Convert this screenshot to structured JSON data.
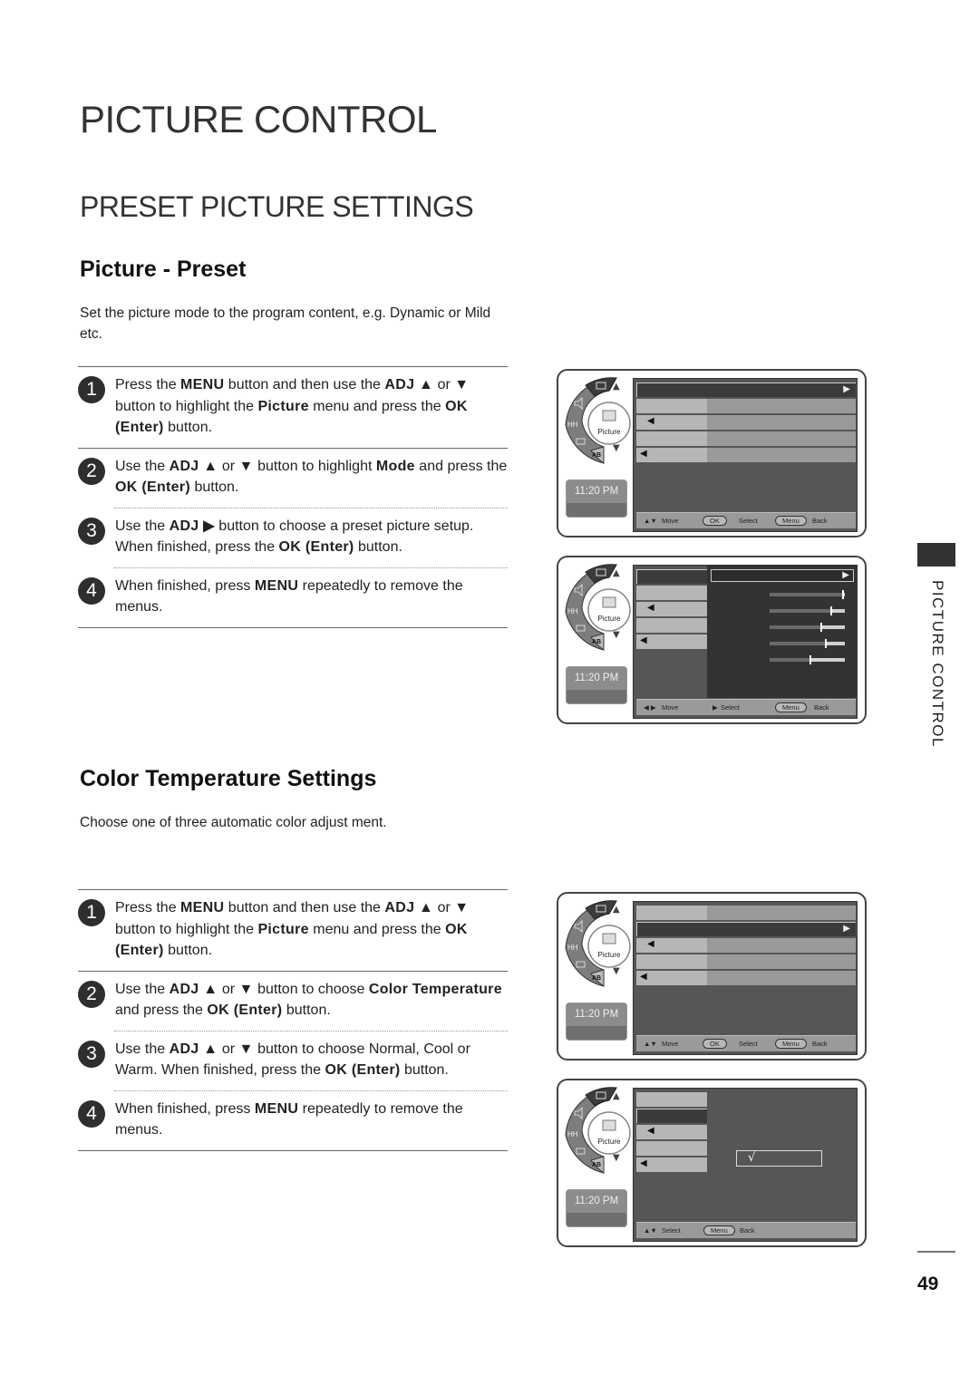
{
  "page": {
    "title": "PICTURE CONTROL",
    "section_title": "PRESET PICTURE SETTINGS",
    "side_label": "PICTURE CONTROL",
    "page_number": "49"
  },
  "preset": {
    "heading": "Picture - Preset",
    "intro": "Set the picture mode to the program content, e.g. Dynamic or Mild etc.",
    "steps": [
      {
        "num": "1",
        "parts": [
          [
            "t",
            "Press the "
          ],
          [
            "b",
            "MENU"
          ],
          [
            "t",
            " button and then use the "
          ],
          [
            "b",
            "ADJ ▲"
          ],
          [
            "t",
            " or "
          ],
          [
            "b",
            "▼"
          ],
          [
            "t",
            " button to highlight the "
          ],
          [
            "b",
            "Picture"
          ],
          [
            "t",
            " menu and press the "
          ],
          [
            "b",
            "OK (Enter)"
          ],
          [
            "t",
            " button."
          ]
        ]
      },
      {
        "num": "2",
        "parts": [
          [
            "t",
            "Use the "
          ],
          [
            "b",
            "ADJ ▲"
          ],
          [
            "t",
            " or "
          ],
          [
            "b",
            "▼"
          ],
          [
            "t",
            " button to highlight "
          ],
          [
            "b",
            "Mode"
          ],
          [
            "t",
            " and press the "
          ],
          [
            "b",
            "OK (Enter)"
          ],
          [
            "t",
            " button."
          ]
        ]
      },
      {
        "num": "3",
        "parts": [
          [
            "t",
            "Use the "
          ],
          [
            "b",
            "ADJ ▶"
          ],
          [
            "t",
            " button to choose a preset picture setup. When finished, press the "
          ],
          [
            "b",
            "OK (Enter)"
          ],
          [
            "t",
            " button."
          ]
        ]
      },
      {
        "num": "4",
        "parts": [
          [
            "t",
            "When finished, press "
          ],
          [
            "b",
            "MENU"
          ],
          [
            "t",
            " repeatedly to remove the menus."
          ]
        ]
      }
    ]
  },
  "colortemp": {
    "heading": "Color Temperature Settings",
    "intro": "Choose one of three automatic color adjust ment.",
    "steps": [
      {
        "num": "1",
        "parts": [
          [
            "t",
            "Press the "
          ],
          [
            "b",
            "MENU"
          ],
          [
            "t",
            " button and then use the "
          ],
          [
            "b",
            "ADJ ▲"
          ],
          [
            "t",
            " or "
          ],
          [
            "b",
            "▼"
          ],
          [
            "t",
            " button to highlight the "
          ],
          [
            "b",
            "Picture"
          ],
          [
            "t",
            " menu and press the "
          ],
          [
            "b",
            "OK (Enter)"
          ],
          [
            "t",
            " button."
          ]
        ]
      },
      {
        "num": "2",
        "parts": [
          [
            "t",
            "Use the "
          ],
          [
            "b",
            "ADJ ▲"
          ],
          [
            "t",
            " or "
          ],
          [
            "b",
            "▼"
          ],
          [
            "t",
            " button to choose "
          ],
          [
            "b",
            "Color Temperature"
          ],
          [
            "t",
            " and press the "
          ],
          [
            "b",
            "OK (Enter)"
          ],
          [
            "t",
            " button."
          ]
        ]
      },
      {
        "num": "3",
        "parts": [
          [
            "t",
            "Use the "
          ],
          [
            "b",
            "ADJ ▲"
          ],
          [
            "t",
            " or "
          ],
          [
            "b",
            "▼"
          ],
          [
            "t",
            " button to choose Normal, Cool or Warm.  When finished, press the "
          ],
          [
            "b",
            "OK (Enter)"
          ],
          [
            "t",
            " button."
          ]
        ]
      },
      {
        "num": "4",
        "parts": [
          [
            "t",
            "When finished, press "
          ],
          [
            "b",
            "MENU"
          ],
          [
            "t",
            " repeatedly to remove the menus."
          ]
        ]
      }
    ]
  },
  "osd": {
    "menu_label": "Picture",
    "time": "11:20 PM",
    "dial_icons": [
      "tv-icon",
      "speaker-icon",
      "antenna-icon",
      "input-icon",
      "ab-icon"
    ],
    "dial_ab": "AB",
    "move_label": "Move",
    "select_label": "Select",
    "back_label": "Back",
    "ok_key": "OK",
    "menu_key": "Menu",
    "check_mark": "√",
    "slider_levels_percent": [
      98,
      82,
      69,
      75,
      54
    ]
  }
}
